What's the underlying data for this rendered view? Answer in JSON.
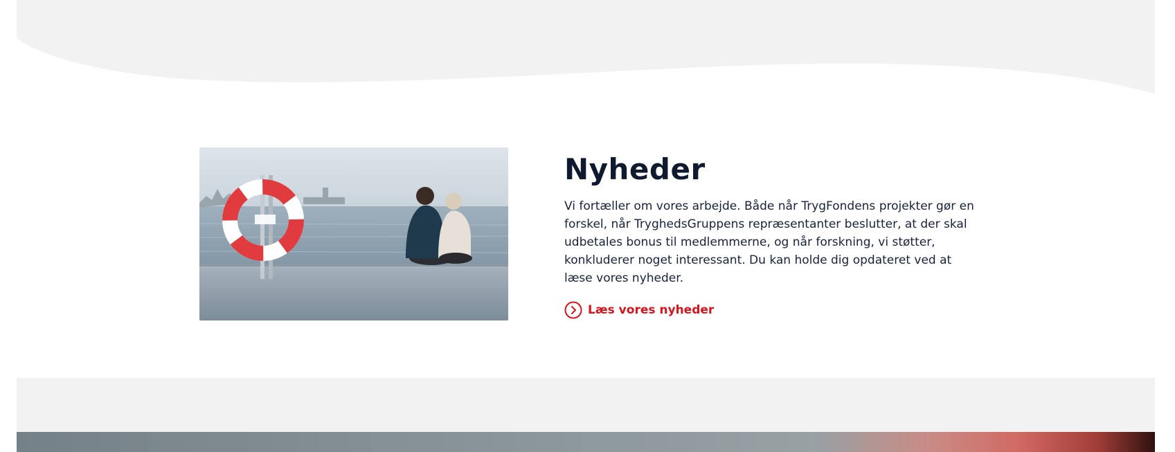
{
  "colors": {
    "background": "#ffffff",
    "gray_band": "#f2f2f2",
    "title": "#0f1a2e",
    "body_text": "#16233a",
    "link_accent": "#d9121b"
  },
  "news": {
    "title": "Nyheder",
    "body": "Vi fortæller om vores arbejde. Både når TrygFondens projekter gør en forskel, når TryghedsGruppens repræsentanter beslutter, at der skal udbetales bonus til medlemmerne, og når forskning, vi støtter, konkluderer noget interessant. Du kan holde dig opdateret ved at læse vores nyheder.",
    "link_label": "Læs vores nyheder",
    "link_icon": "chevron-circle-right-icon",
    "image_subject": "couple sitting on a pier by the sea next to a lifebuoy"
  }
}
